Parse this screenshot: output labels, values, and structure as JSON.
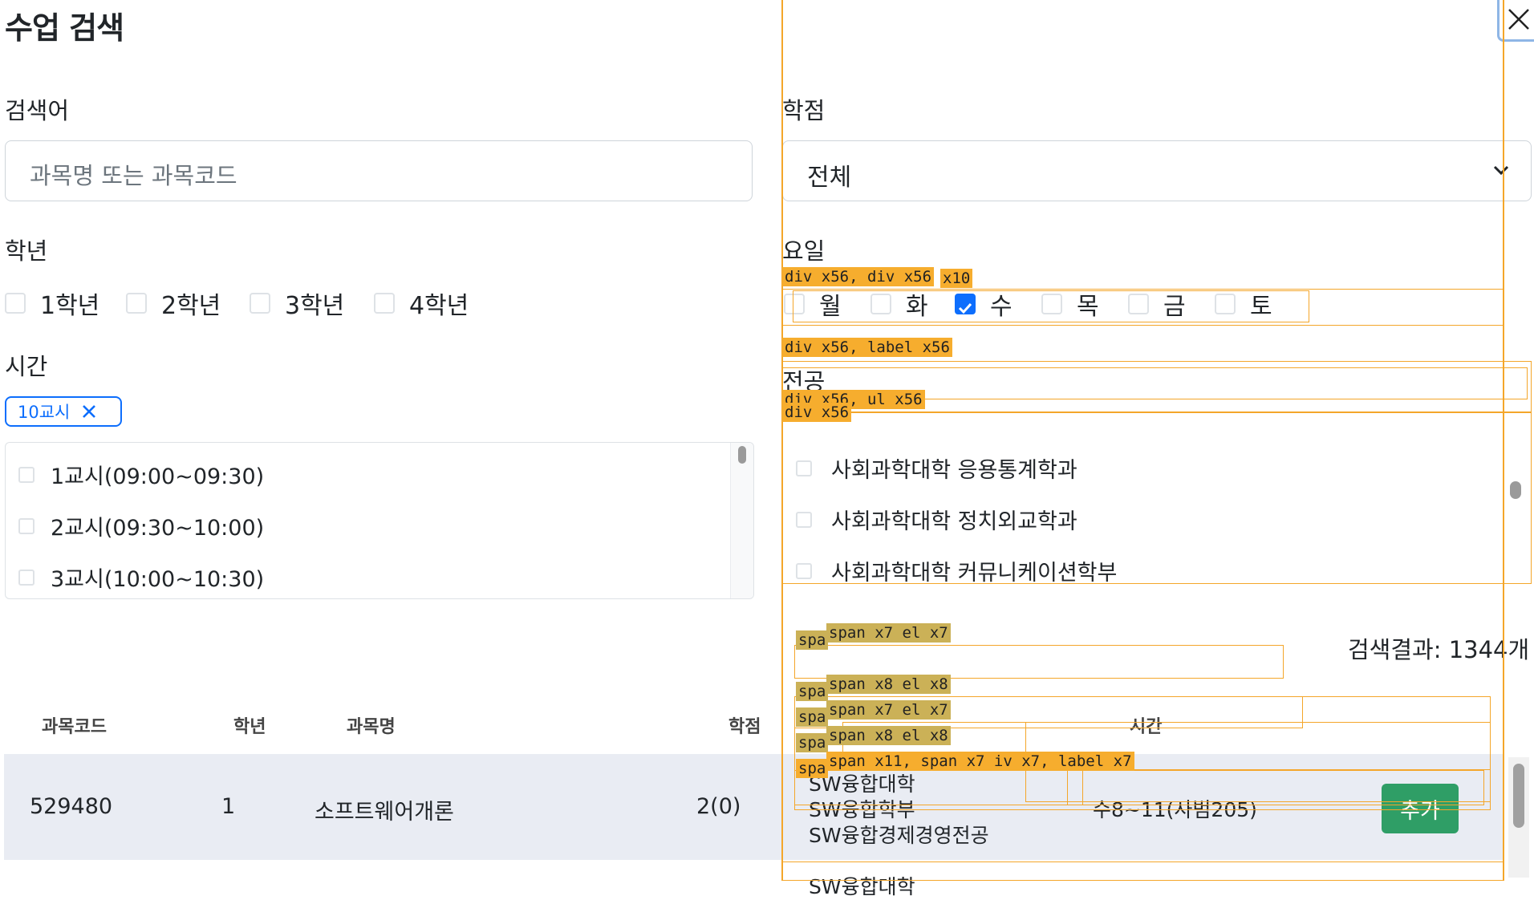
{
  "page_title": "수업 검색",
  "search": {
    "label": "검색어",
    "placeholder": "과목명 또는 과목코드"
  },
  "credit": {
    "label": "학점",
    "value": "전체"
  },
  "grade": {
    "label": "학년",
    "options": [
      "1학년",
      "2학년",
      "3학년",
      "4학년"
    ]
  },
  "days": {
    "label": "요일",
    "options": [
      "월",
      "화",
      "수",
      "목",
      "금",
      "토"
    ],
    "checked": "수"
  },
  "time": {
    "label": "시간",
    "chip": "10교시",
    "options": [
      "1교시(09:00~09:30)",
      "2교시(09:30~10:00)",
      "3교시(10:00~10:30)"
    ]
  },
  "major": {
    "label": "전공",
    "options": [
      "사회과학대학 응용통계학과",
      "사회과학대학 정치외교학과",
      "사회과학대학 커뮤니케이션학부"
    ]
  },
  "result_count": "검색결과: 1344개",
  "table": {
    "headers": {
      "code": "과목코드",
      "grade": "학년",
      "name": "과목명",
      "credit": "학점",
      "time": "시간"
    },
    "rows": [
      {
        "code": "529480",
        "grade": "1",
        "name": "소프트웨어개론",
        "credit": "2(0)",
        "major_lines": [
          "SW융합대학",
          "SW융합학부",
          "SW융합경제경영전공"
        ],
        "time": "수8~11(사범205)",
        "action": "추가"
      }
    ],
    "next_row_partial": "SW융합대학"
  },
  "debug_tags": {
    "t1": "div x56, div x56",
    "t1b": "x10",
    "t2": "div x56, label x56",
    "t3": "div x56, ul x56",
    "t4": "div x56",
    "s1": "spa",
    "s2": "span x7",
    "s3": "el x7",
    "s4": "span x8",
    "s5": "el x8",
    "s6": "span x11, span x7",
    "s7": "iv x7, label x7"
  },
  "colors": {
    "accent": "#0d6efd",
    "add_button": "#2f9e66",
    "overlay": "#f4a62a"
  }
}
